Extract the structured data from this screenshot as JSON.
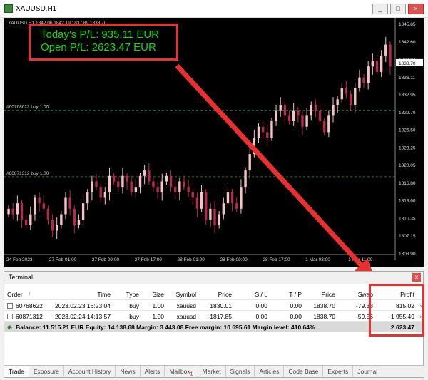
{
  "window": {
    "title": "XAUUSD,H1",
    "buttons": [
      "_",
      "□",
      "×"
    ]
  },
  "chart": {
    "header": "XAUUSD,H1  1842.06 1842.19 1837.89 1838.70",
    "pl_today": "Today's P/L: 935.11 EUR",
    "pl_open": "Open P/L: 2623.47 EUR",
    "order_lines": [
      {
        "label": "#60768622 buy 1.00",
        "price": 1830.01
      },
      {
        "label": "#60871312 buy 1.00",
        "price": 1817.85
      }
    ],
    "price_labels": [
      "1845.85",
      "1842.60",
      "1839.34",
      "1836.11",
      "1832.95",
      "1829.70",
      "1826.50",
      "1823.25",
      "1820.05",
      "1816.80",
      "1813.60",
      "1810.35",
      "1807.15",
      "1803.90"
    ],
    "current_price": "1838.70",
    "time_labels": [
      "24 Feb 2023",
      "27 Feb 01:00",
      "27 Feb 09:00",
      "27 Feb 17:00",
      "28 Feb 01:00",
      "28 Feb 09:00",
      "28 Feb 17:00",
      "1 Mar 03:00",
      "1 Mar 11:00"
    ],
    "colors": {
      "bull": "#f2c4c8",
      "bear": "#b52a4f",
      "order_line": "#1f7a1f",
      "highlight": "#e8312f"
    }
  },
  "terminal": {
    "title": "Terminal",
    "headers": [
      "Order",
      "/",
      "Time",
      "Type",
      "Size",
      "Symbol",
      "Price",
      "S / L",
      "T / P",
      "Price",
      "Swap",
      "Profit"
    ],
    "rows": [
      {
        "order": "60768622",
        "time": "2023.02.23 16:23:04",
        "type": "buy",
        "size": "1.00",
        "symbol": "xauusd",
        "price": "1830.01",
        "sl": "0.00",
        "tp": "0.00",
        "cur_price": "1838.70",
        "swap": "-79.38",
        "profit": "815.02"
      },
      {
        "order": "60871312",
        "time": "2023.02.24 14:13:57",
        "type": "buy",
        "size": "1.00",
        "symbol": "xauusd",
        "price": "1817.85",
        "sl": "0.00",
        "tp": "0.00",
        "cur_price": "1838.70",
        "swap": "-59.56",
        "profit": "1 955.49"
      }
    ],
    "balance_line": "Balance: 11 515.21 EUR  Equity: 14 138.68  Margin: 3 443.08  Free margin: 10 695.61  Margin level: 410.64%",
    "total_profit": "2 623.47",
    "tabs": [
      "Trade",
      "Exposure",
      "Account History",
      "News",
      "Alerts",
      "Mailbox",
      "Market",
      "Signals",
      "Articles",
      "Code Base",
      "Experts",
      "Journal"
    ],
    "mailbox_badge": "1"
  }
}
